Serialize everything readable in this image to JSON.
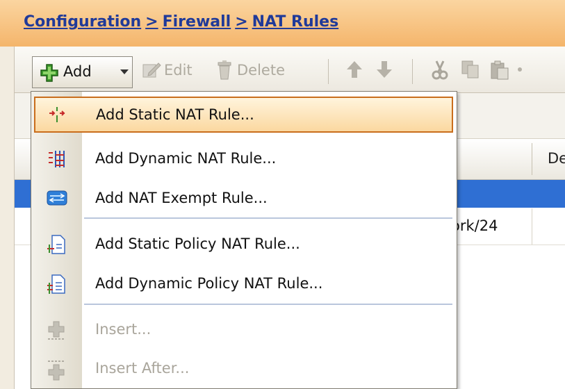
{
  "breadcrumb": {
    "configuration": "Configuration",
    "separator": ">",
    "firewall": "Firewall",
    "nat_rules": "NAT Rules"
  },
  "toolbar": {
    "add_label": "Add",
    "edit_label": "Edit",
    "delete_label": "Delete"
  },
  "table": {
    "column_header_partial": "De",
    "row_cell_partial": "ork/24"
  },
  "add_menu": {
    "items": [
      {
        "label": "Add Static NAT Rule...",
        "icon": "static-nat-icon",
        "enabled": true,
        "highlighted": true
      },
      {
        "label": "Add Dynamic NAT Rule...",
        "icon": "dynamic-nat-icon",
        "enabled": true
      },
      {
        "label": "Add NAT Exempt Rule...",
        "icon": "nat-exempt-icon",
        "enabled": true
      },
      {
        "label": "Add Static Policy NAT Rule...",
        "icon": "static-policy-nat-icon",
        "enabled": true
      },
      {
        "label": "Add Dynamic Policy NAT Rule...",
        "icon": "dynamic-policy-nat-icon",
        "enabled": true
      },
      {
        "label": "Insert...",
        "icon": "insert-icon",
        "enabled": false
      },
      {
        "label": "Insert After...",
        "icon": "insert-after-icon",
        "enabled": false
      }
    ]
  },
  "colors": {
    "header_bg": "#f4b56b",
    "breadcrumb_link": "#203a99",
    "selection_blue": "#2f6fd3",
    "menu_highlight_border": "#c96d1c",
    "menu_highlight_fill": "#fbd8a0"
  }
}
